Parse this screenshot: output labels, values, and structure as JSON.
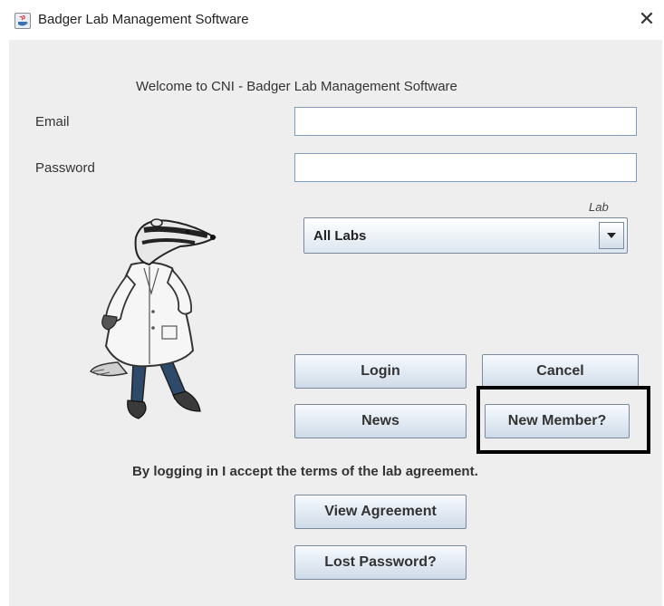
{
  "window": {
    "title": "Badger Lab Management Software",
    "close_symbol": "✕",
    "app_icon": "java-app-icon"
  },
  "form": {
    "welcome": "Welcome to CNI - Badger Lab Management Software",
    "email_label": "Email",
    "email_value": "",
    "password_label": "Password",
    "password_value": "",
    "lab_label": "Lab",
    "lab_selected": "All Labs"
  },
  "buttons": {
    "login": "Login",
    "cancel": "Cancel",
    "news": "News",
    "new_member": "New Member?",
    "view_agreement": "View Agreement",
    "lost_password": "Lost Password?"
  },
  "agreement_text": "By logging in I accept the terms of the lab agreement.",
  "illustration": "badger-lab-coat-illustration",
  "colors": {
    "panel": "#eeeeee",
    "button_top": "#f7faff",
    "button_bottom": "#cfdbe8",
    "highlight": "#000000"
  }
}
